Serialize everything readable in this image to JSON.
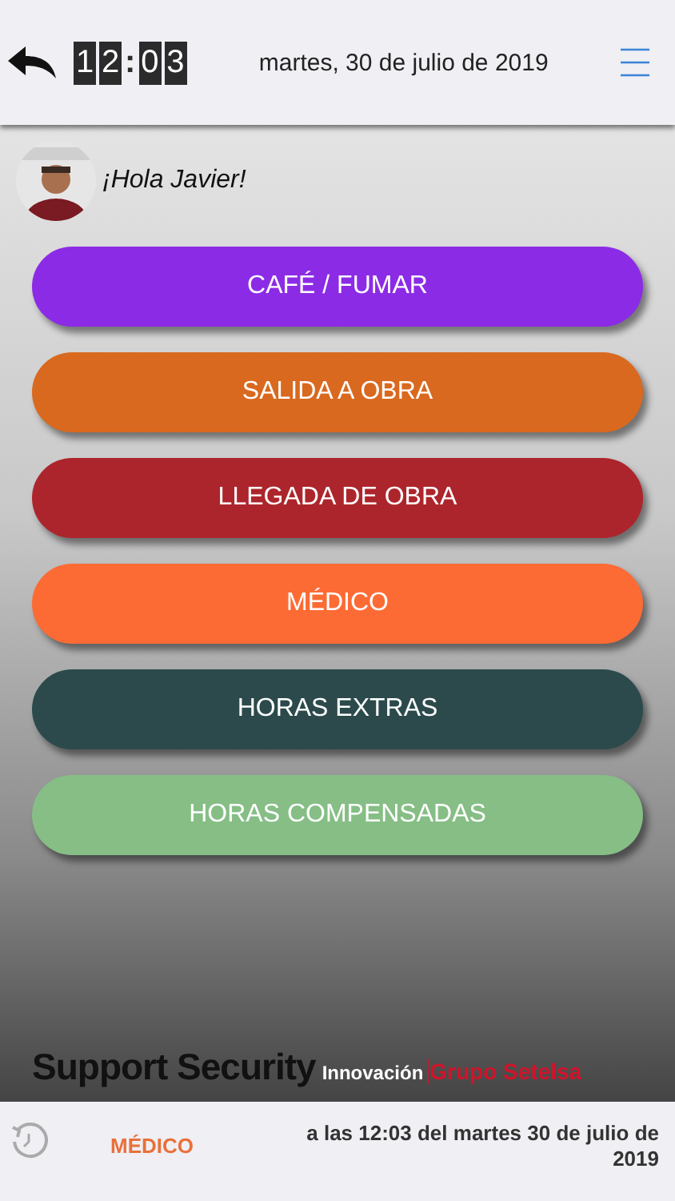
{
  "header": {
    "clock_digits": [
      "1",
      "2",
      ":",
      "0",
      "3"
    ],
    "date": "martes, 30 de julio de 2019"
  },
  "greeting": "¡Hola Javier!",
  "actions": [
    {
      "label": "CAFÉ / FUMAR",
      "color": "#8c2be6"
    },
    {
      "label": "SALIDA A OBRA",
      "color": "#d9691f"
    },
    {
      "label": "LLEGADA DE OBRA",
      "color": "#ad252c"
    },
    {
      "label": "MÉDICO",
      "color": "#fd6b35"
    },
    {
      "label": "HORAS EXTRAS",
      "color": "#2c4a4b"
    },
    {
      "label": "HORAS COMPENSADAS",
      "color": "#86be86"
    }
  ],
  "logo": {
    "brand": "Support Security",
    "tagline": "Innovación",
    "group": "Grupo Setelsa"
  },
  "last_event": {
    "label": "MÉDICO",
    "time": "a las 12:03 del martes 30 de julio de 2019"
  }
}
